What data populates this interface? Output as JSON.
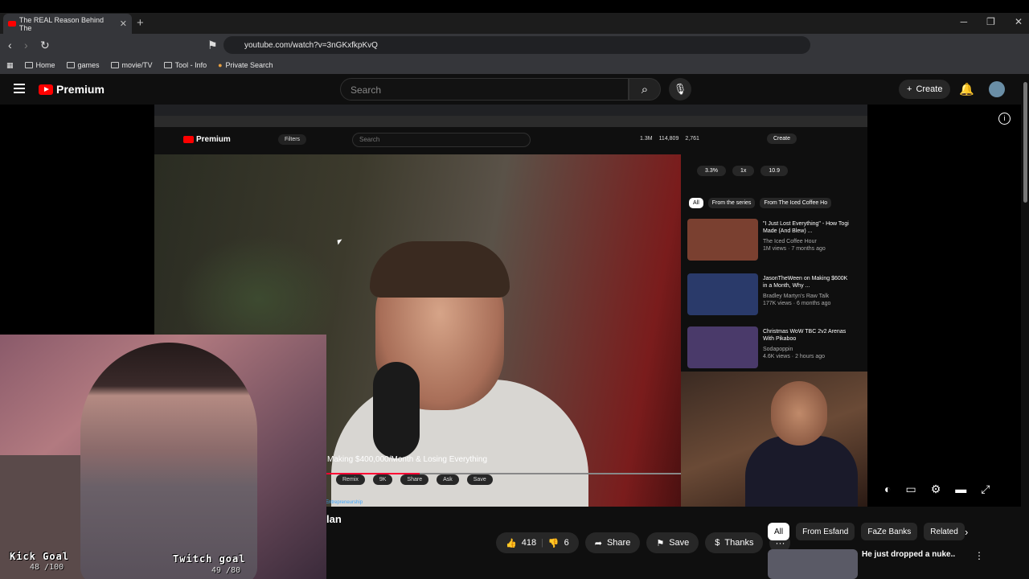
{
  "browser": {
    "tab_title": "The REAL Reason Behind The",
    "tab_close": "✕",
    "new_tab": "+",
    "url": "youtube.com/watch?v=3nGKxfkpKvQ",
    "bookmarks": [
      "Home",
      "games",
      "movie/TV",
      "Tool - Info",
      "Private Search"
    ]
  },
  "youtube": {
    "logo_text": "Premium",
    "search_placeholder": "Search",
    "create_label": "Create",
    "video_title": "lan",
    "likes": "418",
    "dislikes": "6",
    "share_label": "Share",
    "save_label": "Save",
    "thanks_label": "Thanks",
    "more_label": "···",
    "chips": [
      "All",
      "From Esfand",
      "FaZe Banks",
      "Related"
    ],
    "rec_title": "He just dropped a nuke..",
    "info_label": "i"
  },
  "inner_video": {
    "logo_text": "Premium",
    "filters_label": "Filters",
    "search_placeholder": "Search",
    "stats": [
      "1.3M",
      "114,809",
      "2,761"
    ],
    "create_label": "Create",
    "ctrl": [
      "3.3%",
      "1x",
      "10.9"
    ],
    "chips": [
      "All",
      "From the series",
      "From The Iced Coffee Ho"
    ],
    "items": [
      {
        "title": "\"I Just Lost Everything\" - How Togi Made (And Blew) ...",
        "channel": "The Iced Coffee Hour",
        "meta": "1M views · 7 months ago"
      },
      {
        "title": "JasonTheWeen on Making $600K in a Month, Why ...",
        "channel": "Bradley Martyn's Raw Talk",
        "meta": "177K views · 6 months ago"
      },
      {
        "title": "Christmas WoW TBC 2v2 Arenas With Pikaboo",
        "channel": "Sodapoppin",
        "meta": "4.6K views · 2 hours ago"
      }
    ],
    "title": "Making $400,000/Month & Losing Everything",
    "buttons": [
      "Remix",
      "9K",
      "Share",
      "Ask",
      "Save"
    ],
    "link_text": "Entrepreneurship"
  },
  "overlay": {
    "kick_label": "Kick Goal",
    "kick_count": "48 /100",
    "twitch_label": "Twitch goal",
    "twitch_count": "49 /80"
  },
  "colors": {
    "accent": "#ff0000",
    "background": "#0f0f0f"
  }
}
